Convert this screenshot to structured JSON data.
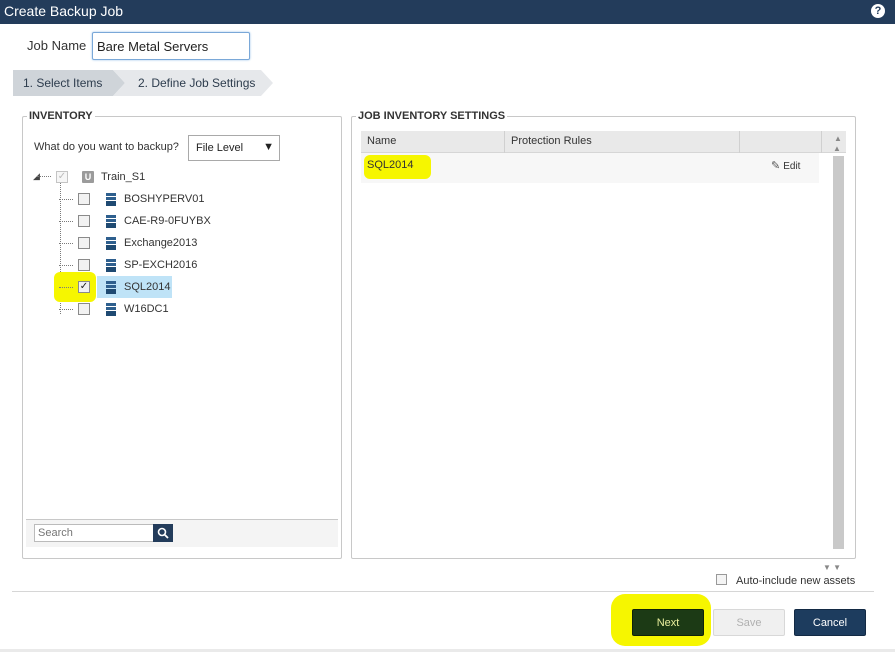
{
  "window": {
    "title": "Create Backup Job",
    "help_icon": "question-circle-icon"
  },
  "job": {
    "name_label": "Job Name",
    "name_value": "Bare Metal Servers"
  },
  "wizard": {
    "steps": [
      {
        "label": "1. Select Items",
        "active": true
      },
      {
        "label": "2. Define Job Settings",
        "active": false
      }
    ]
  },
  "inventory": {
    "legend": "INVENTORY",
    "question": "What do you want to backup?",
    "backup_level": "File Level",
    "root": {
      "label": "Train_S1",
      "icon": "group-u-icon"
    },
    "items": [
      {
        "label": "BOSHYPERV01",
        "checked": false
      },
      {
        "label": "CAE-R9-0FUYBX",
        "checked": false
      },
      {
        "label": "Exchange2013",
        "checked": false
      },
      {
        "label": "SP-EXCH2016",
        "checked": false
      },
      {
        "label": "SQL2014",
        "checked": true
      },
      {
        "label": "W16DC1",
        "checked": false
      }
    ],
    "search_placeholder": "Search"
  },
  "job_inventory": {
    "legend": "JOB INVENTORY SETTINGS",
    "columns": [
      "Name",
      "Protection Rules"
    ],
    "rows": [
      {
        "name": "SQL2014",
        "action": "Edit"
      }
    ]
  },
  "options": {
    "auto_include_label": "Auto-include new assets",
    "auto_include_checked": false
  },
  "buttons": {
    "next": "Next",
    "save": "Save",
    "cancel": "Cancel"
  },
  "colors": {
    "header": "#233c5b",
    "highlight": "#f6f600",
    "selection": "#bfe3f7"
  }
}
